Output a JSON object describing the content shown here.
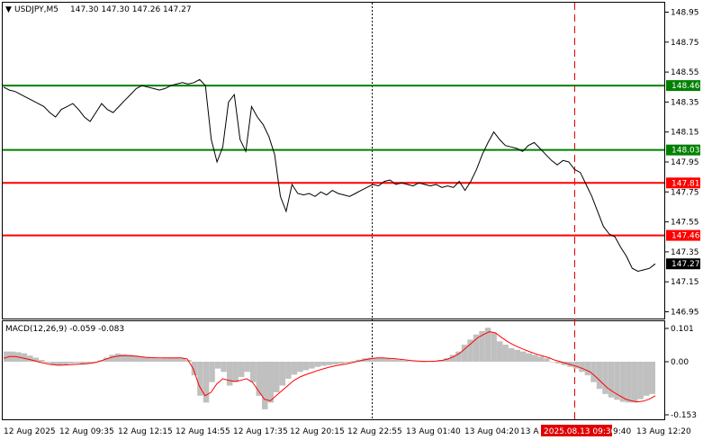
{
  "header": {
    "symbol": "USDJPY,M5",
    "ohlc": "147.30 147.30 147.26 147.27"
  },
  "macd": {
    "label": "MACD(12,26,9) -0.059 -0.083",
    "y_ticks": [
      "0.101",
      "0.00",
      "-0.153"
    ]
  },
  "price_axis": {
    "ticks": [
      "148.95",
      "148.75",
      "148.55",
      "148.35",
      "148.15",
      "147.95",
      "147.75",
      "147.55",
      "147.35",
      "147.15",
      "146.95"
    ]
  },
  "time_axis": {
    "labels": [
      "12 Aug 2025",
      "12 Aug 09:35",
      "12 Aug 12:15",
      "12 Aug 14:55",
      "12 Aug 17:35",
      "12 Aug 20:15",
      "12 Aug 22:55",
      "13 Aug 01:40",
      "13 Aug 04:20",
      "13 A",
      "9:40",
      "13 Aug 12:20"
    ],
    "cursor_label": "2025.08.13 09:30"
  },
  "levels": [
    {
      "price": "148.46",
      "color": "#008000"
    },
    {
      "price": "148.03",
      "color": "#008000"
    },
    {
      "price": "147.81",
      "color": "#ff0000"
    },
    {
      "price": "147.46",
      "color": "#ff0000"
    }
  ],
  "current_price": "147.27",
  "colors": {
    "green_level": "#008000",
    "red_level": "#ff0000",
    "price_line": "#000000",
    "macd_hist": "#c0c0c0",
    "macd_signal": "#ff0000",
    "cursor_line": "#e00000"
  },
  "chart_data": {
    "type": "line",
    "ylim": [
      146.9,
      149.0
    ],
    "series": [
      {
        "values": [
          148.45,
          148.43,
          148.42,
          148.4,
          148.38,
          148.36,
          148.34,
          148.32,
          148.28,
          148.25,
          148.3,
          148.32,
          148.34,
          148.3,
          148.25,
          148.22,
          148.28,
          148.34,
          148.3,
          148.28,
          148.32,
          148.36,
          148.4,
          148.44,
          148.46,
          148.45,
          148.44,
          148.43,
          148.44,
          148.46,
          148.47,
          148.48,
          148.47,
          148.48,
          148.5,
          148.46,
          148.1,
          147.95,
          148.05,
          148.35,
          148.4,
          148.1,
          148.02,
          148.32,
          148.25,
          148.2,
          148.12,
          148.0,
          147.72,
          147.62,
          147.8,
          147.74,
          147.73,
          147.74,
          147.72,
          147.75,
          147.73,
          147.76,
          147.74,
          147.73,
          147.72,
          147.74,
          147.76,
          147.78,
          147.8,
          147.79,
          147.82,
          147.83,
          147.8,
          147.81,
          147.8,
          147.79,
          147.81,
          147.8,
          147.79,
          147.8,
          147.78,
          147.79,
          147.78,
          147.82,
          147.76,
          147.82,
          147.9,
          148.0,
          148.08,
          148.15,
          148.1,
          148.06,
          148.05,
          148.04,
          148.02,
          148.06,
          148.08,
          148.04,
          148.0,
          147.96,
          147.93,
          147.96,
          147.95,
          147.9,
          147.88,
          147.8,
          147.72,
          147.62,
          147.52,
          147.47,
          147.45,
          147.38,
          147.32,
          147.24,
          147.22,
          147.23,
          147.24,
          147.27
        ]
      }
    ],
    "macd": {
      "hist": [
        0.03,
        0.03,
        0.028,
        0.025,
        0.018,
        0.012,
        0.005,
        -0.003,
        -0.01,
        -0.012,
        -0.008,
        -0.005,
        -0.004,
        -0.006,
        -0.005,
        -0.002,
        0.004,
        0.012,
        0.02,
        0.024,
        0.022,
        0.02,
        0.018,
        0.015,
        0.012,
        0.01,
        0.009,
        0.01,
        0.012,
        0.012,
        0.01,
        0.005,
        -0.04,
        -0.1,
        -0.12,
        -0.06,
        -0.02,
        -0.03,
        -0.07,
        -0.06,
        -0.045,
        -0.03,
        -0.06,
        -0.1,
        -0.14,
        -0.12,
        -0.09,
        -0.07,
        -0.05,
        -0.038,
        -0.03,
        -0.025,
        -0.02,
        -0.015,
        -0.012,
        -0.01,
        -0.008,
        -0.006,
        -0.003,
        0.002,
        0.006,
        0.01,
        0.012,
        0.012,
        0.011,
        0.009,
        0.007,
        0.005,
        0.003,
        0.001,
        0.0,
        0.0,
        0.001,
        0.002,
        0.005,
        0.01,
        0.02,
        0.03,
        0.05,
        0.065,
        0.08,
        0.09,
        0.1,
        0.085,
        0.06,
        0.05,
        0.04,
        0.035,
        0.03,
        0.025,
        0.02,
        0.015,
        0.01,
        0.0,
        -0.005,
        -0.01,
        -0.015,
        -0.02,
        -0.03,
        -0.04,
        -0.06,
        -0.08,
        -0.095,
        -0.105,
        -0.112,
        -0.118,
        -0.12,
        -0.12,
        -0.11,
        -0.1,
        -0.095
      ],
      "signal": [
        0.01,
        0.015,
        0.015,
        0.012,
        0.008,
        0.004,
        -0.001,
        -0.005,
        -0.008,
        -0.01,
        -0.01,
        -0.009,
        -0.008,
        -0.007,
        -0.006,
        -0.004,
        0.0,
        0.006,
        0.012,
        0.016,
        0.018,
        0.018,
        0.017,
        0.015,
        0.013,
        0.012,
        0.011,
        0.011,
        0.011,
        0.011,
        0.011,
        0.008,
        -0.02,
        -0.07,
        -0.1,
        -0.09,
        -0.065,
        -0.05,
        -0.055,
        -0.058,
        -0.055,
        -0.05,
        -0.06,
        -0.085,
        -0.11,
        -0.115,
        -0.1,
        -0.085,
        -0.07,
        -0.055,
        -0.045,
        -0.038,
        -0.032,
        -0.026,
        -0.021,
        -0.016,
        -0.012,
        -0.009,
        -0.006,
        -0.002,
        0.002,
        0.006,
        0.009,
        0.011,
        0.011,
        0.01,
        0.009,
        0.007,
        0.005,
        0.003,
        0.002,
        0.001,
        0.001,
        0.002,
        0.004,
        0.008,
        0.015,
        0.025,
        0.04,
        0.055,
        0.07,
        0.08,
        0.088,
        0.085,
        0.072,
        0.06,
        0.05,
        0.042,
        0.035,
        0.028,
        0.022,
        0.017,
        0.012,
        0.005,
        0.0,
        -0.005,
        -0.01,
        -0.015,
        -0.022,
        -0.03,
        -0.045,
        -0.062,
        -0.078,
        -0.09,
        -0.1,
        -0.11,
        -0.115,
        -0.118,
        -0.116,
        -0.11,
        -0.1
      ]
    }
  }
}
